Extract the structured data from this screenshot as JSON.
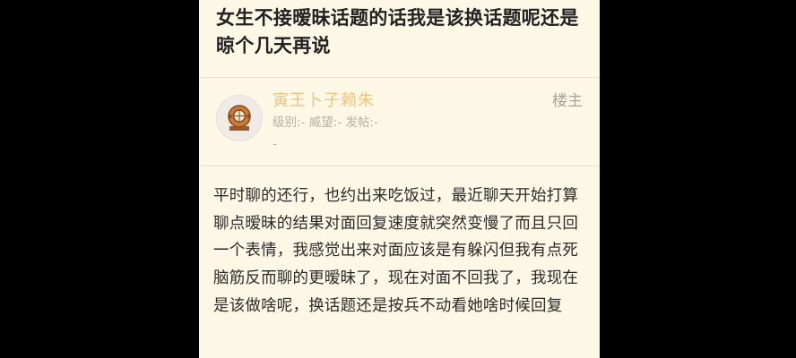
{
  "post": {
    "title": "女生不接暧昧话题的话我是该换话题呢还是晾个几天再说",
    "author": {
      "name": "寅王卜子赖朱",
      "badge": "楼主",
      "level_label": "级别:-",
      "reputation_label": "威望:-",
      "posts_label": "发帖:-",
      "extra": "-"
    },
    "body": "平时聊的还行，也约出来吃饭过，最近聊天开始打算聊点暧昧的结果对面回复速度就突然变慢了而且只回一个表情，我感觉出来对面应该是有躲闪但我有点死脑筋反而聊的更暧昧了，现在对面不回我了，我现在是该做啥呢，换话题还是按兵不动看她啥时候回复"
  },
  "colors": {
    "outer_background": "#000000",
    "page_background": "#fdf8e6",
    "username": "#eec47e",
    "meta": "#b4aea4",
    "text": "#2a2a2a"
  },
  "icons": {
    "avatar": "diving-helmet-icon"
  }
}
